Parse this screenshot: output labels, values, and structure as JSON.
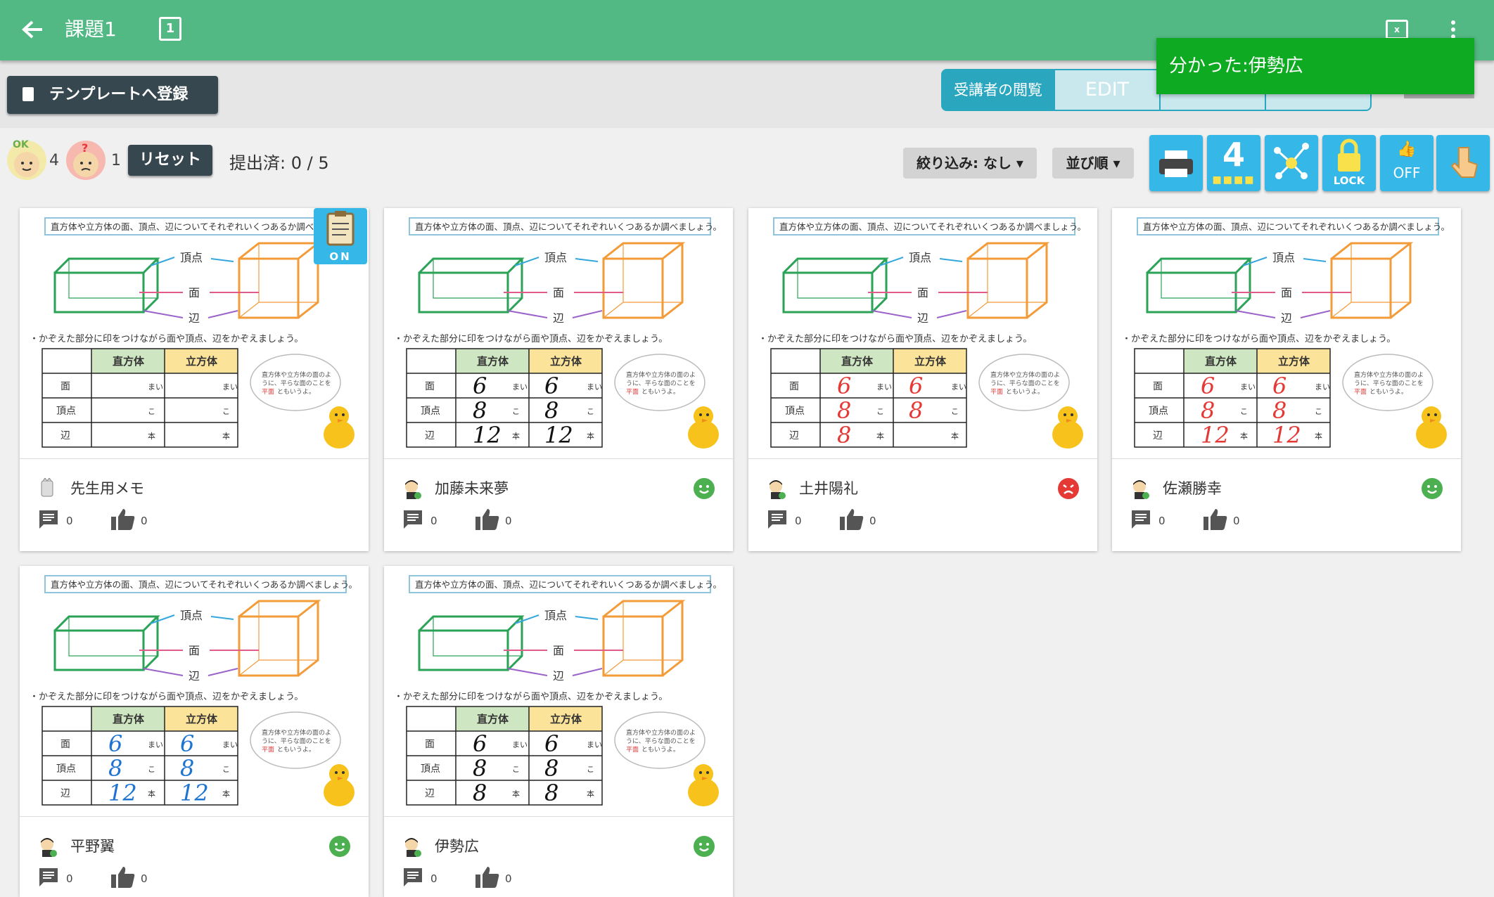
{
  "header": {
    "title": "課題1",
    "page_icon_label": "1",
    "x_icon_label": "x"
  },
  "toolbar": {
    "template_button": "テンプレートへ登録",
    "viewer_label": "受講者の閲覧",
    "viewer_options": [
      "EDIT",
      "",
      ""
    ]
  },
  "toast": "分かった:伊勢広",
  "reactions": {
    "ok_label": "OK",
    "ok_count": "4",
    "question_count": "1",
    "reset_button": "リセット",
    "submitted": "提出済: 0 / 5"
  },
  "controls": {
    "filter": "絞り込み: なし",
    "sort": "並び順",
    "tool_count": "4",
    "lock_label": "LOCK",
    "off_label": "OFF"
  },
  "worksheet": {
    "instruction": "直方体や立方体の面、頂点、辺についてそれぞれいくつあるか調べましょう。",
    "vertex": "頂点",
    "face": "面",
    "edge": "辺",
    "mark_note": "・かぞえた部分に印をつけながら面や頂点、辺をかぞえましょう。",
    "col_rect": "直方体",
    "col_cube": "立方体",
    "unit_face": "まい",
    "unit_vertex": "こ",
    "unit_edge": "本",
    "bubble": "直方体や立方体の面のように、平らな面のことを平面ともいうよ。",
    "memo_on": "ON"
  },
  "cards": [
    {
      "name": "先生用メモ",
      "comments": "0",
      "likes": "0",
      "answers": [
        "",
        "",
        "",
        "",
        "",
        ""
      ],
      "ink": "#000000",
      "status": "none"
    },
    {
      "name": "加藤未来夢",
      "comments": "0",
      "likes": "0",
      "answers": [
        "6",
        "6",
        "8",
        "8",
        "12",
        "12"
      ],
      "ink": "#111111",
      "status": "smile"
    },
    {
      "name": "土井陽礼",
      "comments": "0",
      "likes": "0",
      "answers": [
        "6",
        "6",
        "8",
        "8",
        "8",
        ""
      ],
      "ink": "#e53935",
      "status": "sad"
    },
    {
      "name": "佐瀬勝幸",
      "comments": "0",
      "likes": "0",
      "answers": [
        "6",
        "6",
        "8",
        "8",
        "12",
        "12"
      ],
      "ink": "#e53935",
      "status": "smile"
    },
    {
      "name": "平野翼",
      "comments": "0",
      "likes": "0",
      "answers": [
        "6",
        "6",
        "8",
        "8",
        "12",
        "12"
      ],
      "ink": "#1e74d0",
      "status": "smile"
    },
    {
      "name": "伊勢広",
      "comments": "0",
      "likes": "0",
      "answers": [
        "6",
        "6",
        "8",
        "8",
        "8",
        "8"
      ],
      "ink": "#111111",
      "status": "smile"
    }
  ],
  "colors": {
    "header": "#52b884",
    "tool": "#35b7e8",
    "toast": "#0eab22",
    "smile": "#4caf50",
    "sad": "#e53935"
  }
}
